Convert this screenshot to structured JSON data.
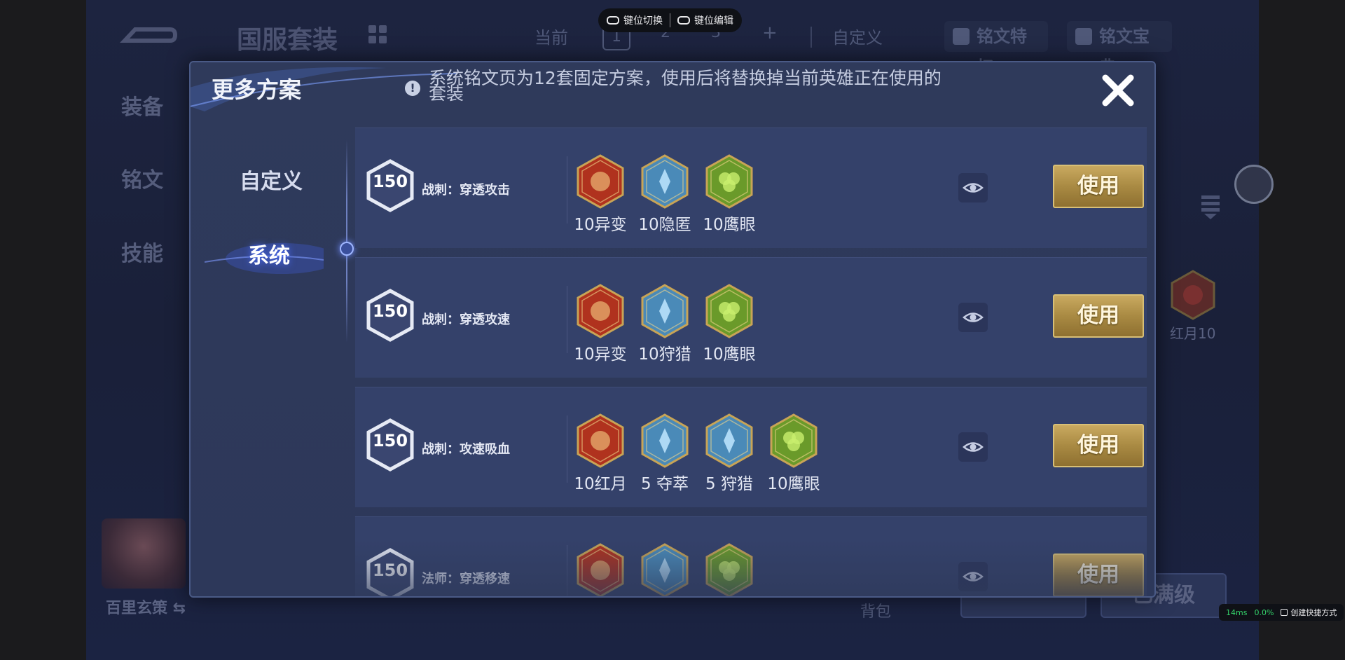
{
  "background": {
    "page_title": "国服套装",
    "current_label": "当前",
    "slots": [
      "1",
      "2",
      "3"
    ],
    "plus": "+",
    "custom_label": "自定义",
    "privilege_label": "铭文特权",
    "dictionary_label": "铭文宝典",
    "side_tabs": [
      "装备",
      "铭文",
      "技能"
    ],
    "hero_name": "百里玄策 ⇆",
    "red_moon_label": "红月10",
    "bag_label": "背包",
    "max_level_label": "已满级"
  },
  "overlay": {
    "key_switch": "键位切换",
    "key_edit": "键位编辑",
    "latency": "14ms",
    "loss": "0.0%",
    "shortcut": "创建快捷方式"
  },
  "modal": {
    "title": "更多方案",
    "notice": "系统铭文页为12套固定方案，使用后将替换掉当前英雄正在使用的套装",
    "nav": {
      "custom": "自定义",
      "system": "系统"
    },
    "rows": [
      {
        "level": "150",
        "name": "战刺：穿透攻击",
        "use": "使用",
        "runes": [
          {
            "label": "10异变",
            "color": "#b0321e"
          },
          {
            "label": "10隐匿",
            "color": "#4a8ab8"
          },
          {
            "label": "10鹰眼",
            "color": "#6a9a2a"
          }
        ]
      },
      {
        "level": "150",
        "name": "战刺：穿透攻速",
        "use": "使用",
        "runes": [
          {
            "label": "10异变",
            "color": "#b0321e"
          },
          {
            "label": "10狩猎",
            "color": "#4a8ab8"
          },
          {
            "label": "10鹰眼",
            "color": "#6a9a2a"
          }
        ]
      },
      {
        "level": "150",
        "name": "战刺：攻速吸血",
        "use": "使用",
        "runes": [
          {
            "label": "10红月",
            "color": "#b0321e"
          },
          {
            "label": "5 夺萃",
            "color": "#4a8ab8"
          },
          {
            "label": "5 狩猎",
            "color": "#4a8ab8"
          },
          {
            "label": "10鹰眼",
            "color": "#6a9a2a"
          }
        ]
      },
      {
        "level": "150",
        "name": "法师：穿透移速",
        "use": "使用",
        "runes": [
          {
            "label": "",
            "color": "#b0321e"
          },
          {
            "label": "",
            "color": "#4a8ab8"
          },
          {
            "label": "",
            "color": "#6a9a2a"
          }
        ]
      }
    ]
  }
}
